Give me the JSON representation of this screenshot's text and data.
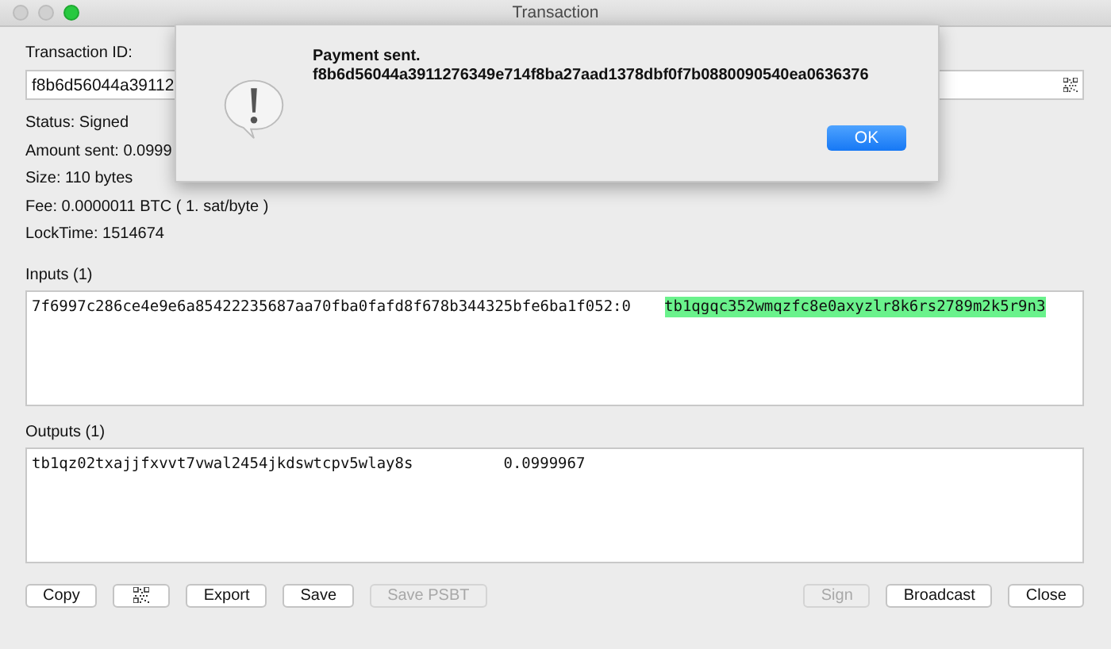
{
  "window": {
    "title": "Transaction"
  },
  "details": {
    "txid_label": "Transaction ID:",
    "txid_value": "f8b6d56044a39112",
    "lines": [
      "Status: Signed",
      "Amount sent: 0.0999",
      "Size: 110 bytes",
      "Fee: 0.0000011 BTC  ( 1. sat/byte )",
      "LockTime: 1514674"
    ]
  },
  "inputs": {
    "label": "Inputs (1)",
    "rows": [
      {
        "prevout": "7f6997c286ce4e9e6a85422235687aa70fba0fafd8f678b344325bfe6ba1f052:0",
        "address": "tb1qgqc352wmqzfc8e0axyzlr8k6rs2789m2k5r9n3",
        "highlighted": true
      }
    ]
  },
  "outputs": {
    "label": "Outputs (1)",
    "rows": [
      {
        "address": "tb1qz02txajjfxvvt7vwal2454jkdswtcpv5wlay8s",
        "amount": "0.0999967"
      }
    ]
  },
  "buttons_left": [
    {
      "kind": "text",
      "label": "Copy",
      "disabled": false
    },
    {
      "kind": "qr",
      "disabled": false
    },
    {
      "kind": "text",
      "label": "Export",
      "disabled": false
    },
    {
      "kind": "text",
      "label": "Save",
      "disabled": false
    },
    {
      "kind": "text",
      "label": "Save PSBT",
      "disabled": true
    }
  ],
  "buttons_right": [
    {
      "kind": "text",
      "label": "Sign",
      "disabled": true
    },
    {
      "kind": "text",
      "label": "Broadcast",
      "disabled": false
    },
    {
      "kind": "text",
      "label": "Close",
      "disabled": false
    }
  ],
  "dialog": {
    "title": "Payment sent.",
    "message": "f8b6d56044a3911276349e714f8ba27aad1378dbf0f7b0880090540ea0636376",
    "button": "OK"
  }
}
